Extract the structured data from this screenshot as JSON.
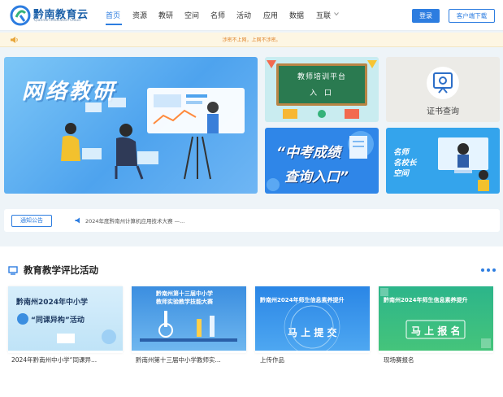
{
  "header": {
    "logo_name": "黔南教育云",
    "logo_sub": "Qiannan Education Cloud",
    "nav": [
      {
        "label": "首页",
        "active": true
      },
      {
        "label": "资源"
      },
      {
        "label": "教研"
      },
      {
        "label": "空间"
      },
      {
        "label": "名师"
      },
      {
        "label": "活动"
      },
      {
        "label": "应用"
      },
      {
        "label": "数据"
      },
      {
        "label": "互联"
      }
    ],
    "login_label": "登录",
    "client_label": "客户端下载"
  },
  "notice": {
    "text": "涉密不上网，上网不涉密。"
  },
  "banners": {
    "main_title": "网络教研",
    "train_line1": "教师培训平台",
    "train_line2": "入 口",
    "cert_label": "证书查询",
    "exam_line1": "“中考成绩",
    "exam_line2": "查询入口”",
    "famous_lines": [
      "名师",
      "名校长",
      "空间"
    ]
  },
  "announcement": {
    "tag": "通知公告",
    "text": "2024年度黔南州计算机应用技术大赛 —..."
  },
  "section": {
    "title": "教育教学评比活动",
    "cards": [
      {
        "image_text1": "黔南州2024年中小学",
        "image_text2": "“同课异构”活动",
        "label": "2024年黔南州中小学“同课异..."
      },
      {
        "image_text1": "黔南州第十三届中小学",
        "image_text2": "教师实验教学技能大赛",
        "label": "黔南州第十三届中小学教师实..."
      },
      {
        "image_text1": "黔南州2024年师生信息素养提升",
        "image_text2": "马 上 提 交",
        "label": "上传作品"
      },
      {
        "image_text1": "黔南州2024年师生信息素养提升",
        "image_text2": "马 上 报 名",
        "label": "现场赛报名"
      }
    ]
  },
  "colors": {
    "accent": "#2d7de0",
    "notice": "#e0862e"
  }
}
